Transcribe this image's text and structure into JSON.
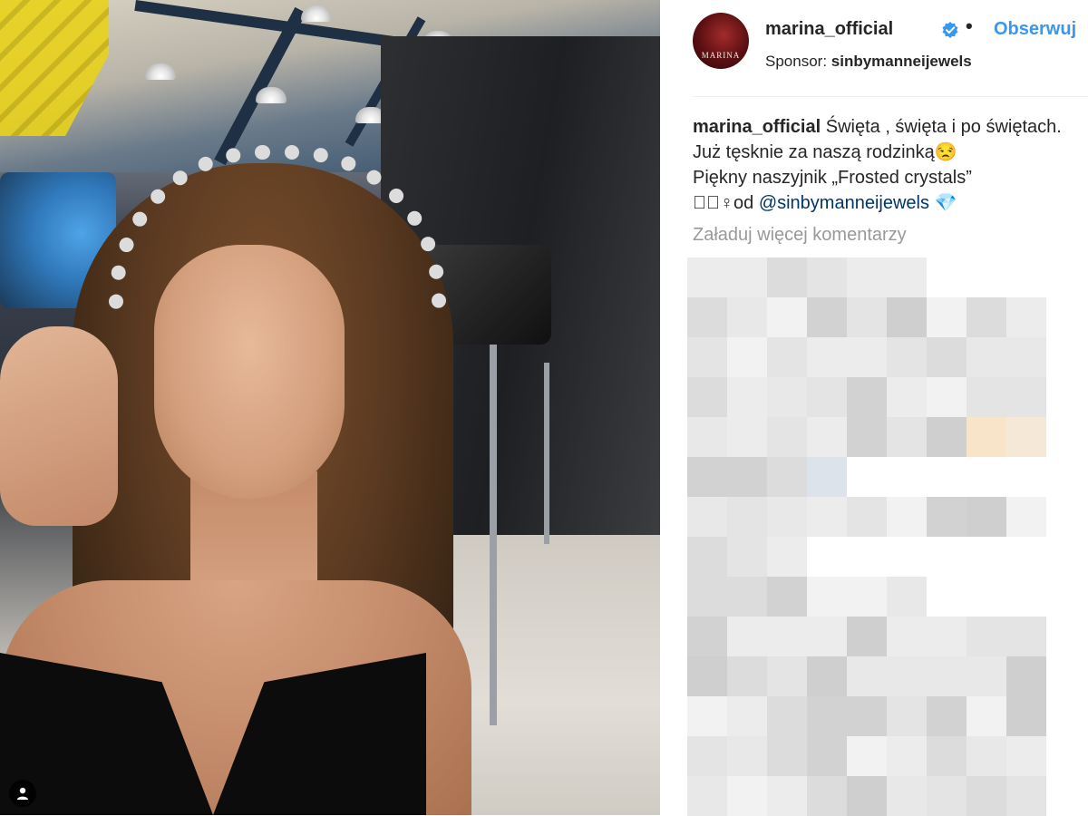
{
  "post": {
    "username": "marina_official",
    "avatar_label": "MARINA",
    "separator": "•",
    "follow_label": "Obserwuj",
    "sponsor_prefix": "Sponsor:",
    "sponsor_name": "sinbymanneijewels"
  },
  "caption": {
    "username": "marina_official",
    "line1": " Święta , święta i po świętach. Już tęsknie za naszą rodzinką😒",
    "line2": "Piękny naszyjnik „Frosted crystals”",
    "line3_prefix": "◻🏼‍♀od ",
    "mention": "@sinbymanneijewels",
    "line3_suffix": " 💎"
  },
  "comments": {
    "load_more_label": "Załaduj więcej komentarzy"
  },
  "icons": {
    "verified": "verified-badge-icon",
    "user_tag": "user-tag-icon"
  },
  "colors": {
    "accent": "#3897f0",
    "text": "#262626",
    "muted": "#999999",
    "verified": "#3897f0"
  }
}
